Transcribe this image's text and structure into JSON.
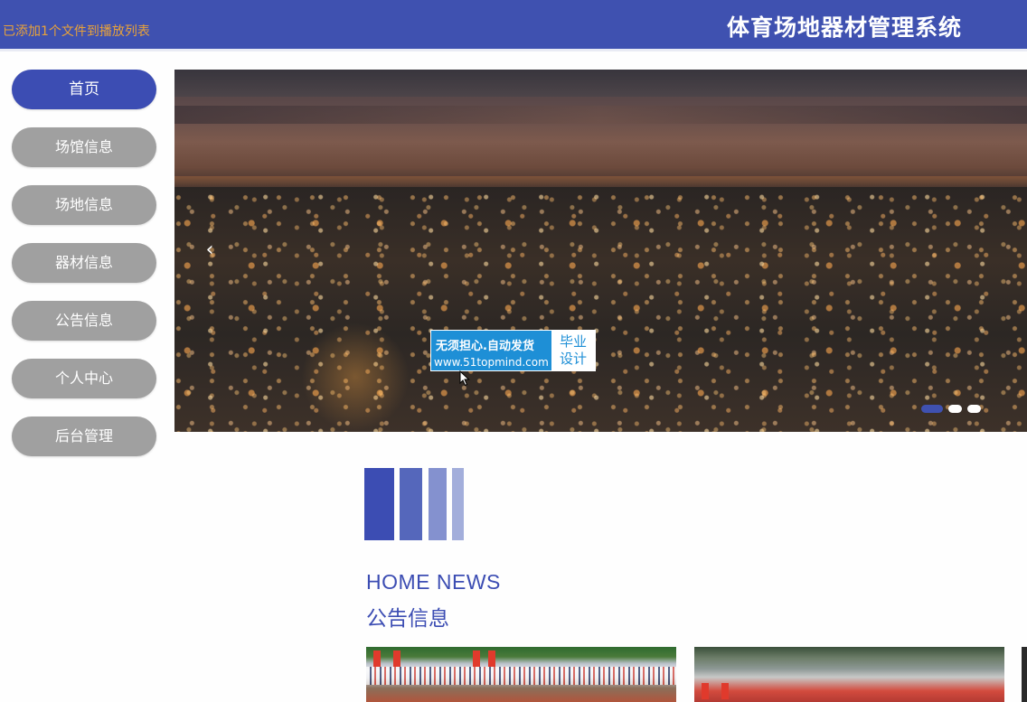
{
  "header": {
    "notice": "已添加1个文件到播放列表",
    "title": "体育场地器材管理系统",
    "background": "#3f51b0",
    "notice_color": "#e8a23a"
  },
  "sidebar": {
    "items": [
      {
        "label": "首页",
        "active": true
      },
      {
        "label": "场馆信息",
        "active": false
      },
      {
        "label": "场地信息",
        "active": false
      },
      {
        "label": "器材信息",
        "active": false
      },
      {
        "label": "公告信息",
        "active": false
      },
      {
        "label": "个人中心",
        "active": false
      },
      {
        "label": "后台管理",
        "active": false
      }
    ],
    "active_color": "#3c4db3",
    "inactive_color": "#a0a0a0"
  },
  "banner": {
    "prev_icon": "chevron-left-icon",
    "prev_glyph": "‹",
    "slide_count": 3,
    "active_slide": 1,
    "image": "night-city-skyline"
  },
  "watermark": {
    "line1": "无须担心.自动发货",
    "line2": "www.51topmind.com",
    "side_line1": "毕业",
    "side_line2": "设计"
  },
  "section": {
    "title_en": "HOME NEWS",
    "title_cn": "公告信息",
    "accent": "#3c4db3"
  },
  "news": {
    "cards": [
      {
        "image": "sports-ceremony-photo"
      },
      {
        "image": "track-field-photo"
      },
      {
        "image": "partial-photo"
      }
    ]
  }
}
